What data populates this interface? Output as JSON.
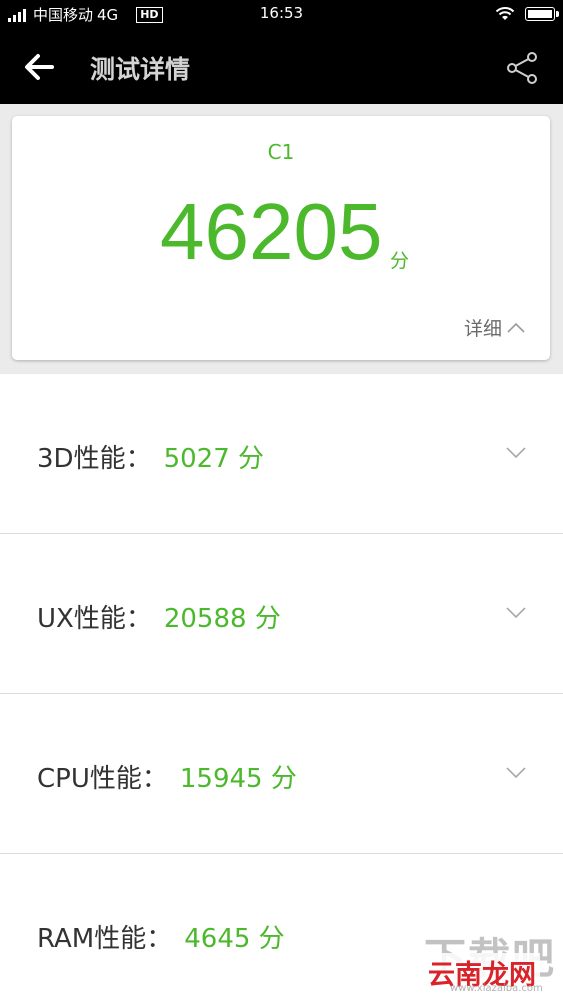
{
  "status_bar": {
    "carrier": "中国移动",
    "network": "4G",
    "hd_badge": "HD",
    "time": "16:53"
  },
  "app_bar": {
    "title": "测试详情",
    "back_icon": "back-arrow-icon",
    "share_icon": "share-icon"
  },
  "summary": {
    "device": "C1",
    "score": "46205",
    "unit": "分",
    "detail_label": "详细"
  },
  "rows": [
    {
      "label": "3D性能：",
      "value": "5027 分"
    },
    {
      "label": "UX性能：",
      "value": "20588 分"
    },
    {
      "label": "CPU性能：",
      "value": "15945 分"
    },
    {
      "label": "RAM性能：",
      "value": "4645 分"
    }
  ],
  "watermark": {
    "top": "下载吧",
    "main": "云南龙网",
    "sub": "www.xiazaiba.com"
  },
  "colors": {
    "accent": "#4cb82c",
    "app_bar": "#000000",
    "background": "#ebebeb"
  }
}
